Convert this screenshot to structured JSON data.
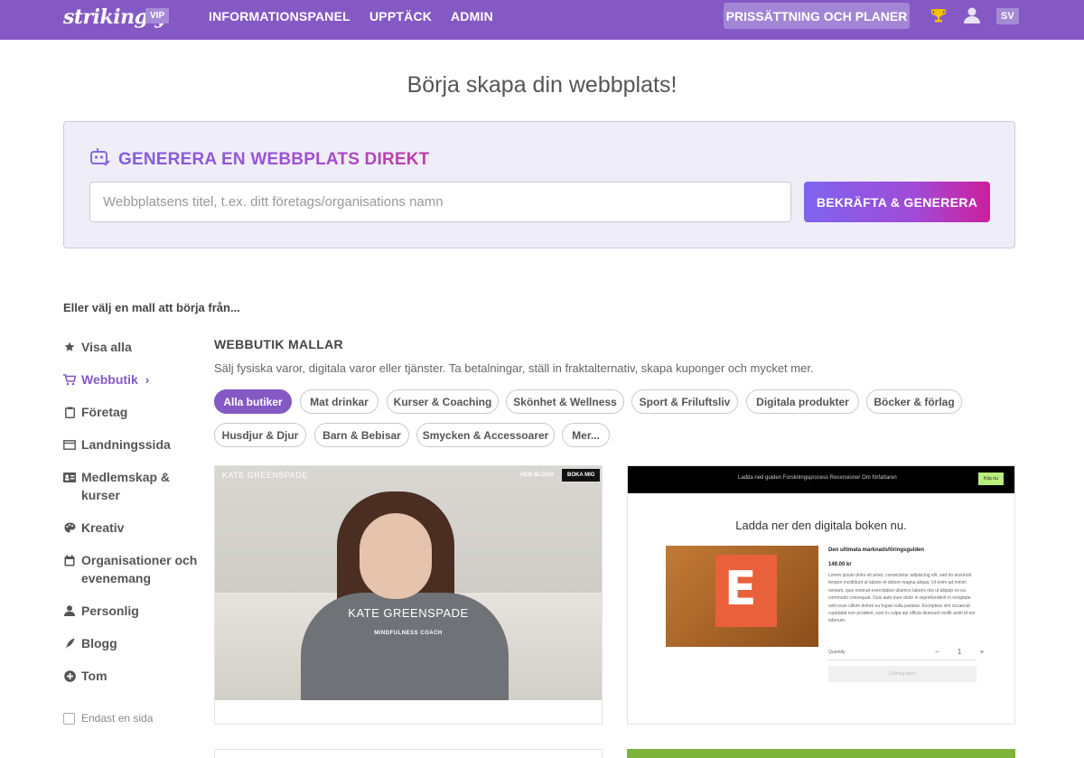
{
  "topbar": {
    "logo": "strikingly",
    "vip_badge": "VIP",
    "nav": [
      "INFORMATIONSPANEL",
      "UPPTÄCK",
      "ADMIN"
    ],
    "pricing_button": "PRISSÄTTNING OCH PLANER",
    "language": "SV",
    "icons": [
      "trophy-icon",
      "user-icon"
    ],
    "colors": {
      "bar": "#8559c4",
      "trophy": "#f2c200"
    }
  },
  "hero": {
    "title": "Börja skapa din webbplats!"
  },
  "generator": {
    "heading_prefix": "GENERERA EN ",
    "heading_suffix": "WEBBPLATS DIREKT",
    "input_placeholder": "Webbplatsens titel, t.ex. ditt företags/organisations namn",
    "input_value": "",
    "button": "BEKRÄFTA & GENERERA"
  },
  "choose_label": "Eller välj en mall att börja från...",
  "sidebar": {
    "items": [
      {
        "label": "Visa alla",
        "icon": "star-icon"
      },
      {
        "label": "Webbutik",
        "icon": "cart-icon",
        "active": true
      },
      {
        "label": "Företag",
        "icon": "clipboard-icon"
      },
      {
        "label": "Landningssida",
        "icon": "window-icon"
      },
      {
        "label": "Medlemskap & kurser",
        "icon": "id-card-icon"
      },
      {
        "label": "Kreativ",
        "icon": "palette-icon"
      },
      {
        "label": "Organisationer och evenemang",
        "icon": "calendar-icon"
      },
      {
        "label": "Personlig",
        "icon": "person-icon"
      },
      {
        "label": "Blogg",
        "icon": "quill-icon"
      },
      {
        "label": "Tom",
        "icon": "plus-circle-icon"
      }
    ],
    "single_page_label": "Endast en sida",
    "active_color": "#8559c4"
  },
  "category": {
    "title": "WEBBUTIK MALLAR",
    "description": "Sälj fysiska varor, digitala varor eller tjänster. Ta betalningar, ställ in fraktalternativ, skapa kuponger och mycket mer.",
    "filters": [
      "Alla butiker",
      "Mat drinkar",
      "Kurser & Coaching",
      "Skönhet & Wellness",
      "Sport & Friluftsliv",
      "Digitala produkter",
      "Böcker & förlag",
      "Husdjur & Djur",
      "Barn & Bebisar",
      "Smycken & Accessoarer",
      "Mer..."
    ],
    "active_filter": "Alla butiker"
  },
  "templates": [
    {
      "nav_name": "KATE GREENSPADE",
      "nav_links": "HEM   BLOGG",
      "nav_button": "BOKA MIG",
      "title": "KATE GREENSPADE",
      "subtitle": "MINDFULNESS COACH"
    },
    {
      "nav_links": "Ladda ned guiden     Forskningsprocess     Recensioner     Om författaren",
      "nav_button": "Köp nu",
      "heading": "Ladda ner den digitala boken nu.",
      "product_title": "Den ultimata marknadsföringsguiden",
      "price": "149.00 kr",
      "body": "Lorem ipsum dolor sit amet, consectetur adipiscing elit, sed do eiusmod tempor incididunt ut labore et dolore magna aliqua. Ut enim ad minim veniam, quis nostrud exercitation ullamco laboris nisi ut aliquip ex ea commodo consequat. Duis aute irure dolor in reprehenderit in voluptate velit esse cillum dolore eu fugiat nulla pariatur. Excepteur sint occaecat cupidatat non proident, sunt in culpa qui officia deserunt mollit anim id est laborum.",
      "quantity_label": "Quantity",
      "quantity_value": "−  1  +",
      "cta": "Coming soon"
    }
  ]
}
